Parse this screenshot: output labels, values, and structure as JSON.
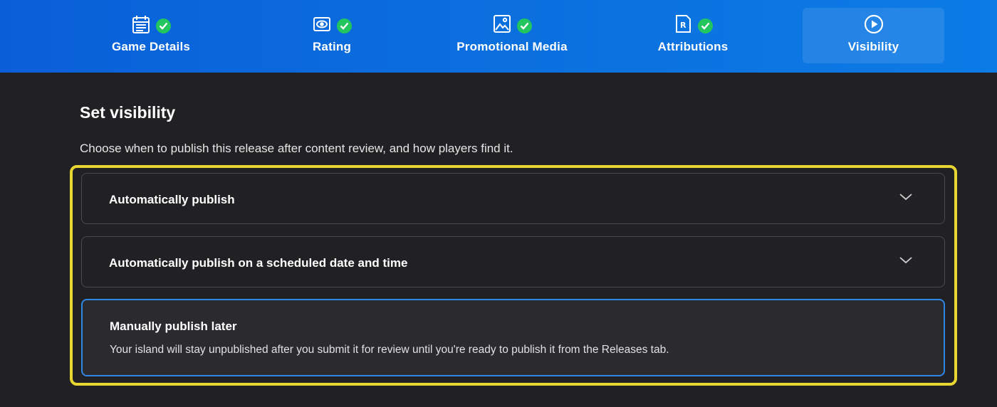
{
  "steps": [
    {
      "label": "Game Details",
      "icon": "calendar-icon",
      "completed": true,
      "active": false
    },
    {
      "label": "Rating",
      "icon": "eye-icon",
      "completed": true,
      "active": false
    },
    {
      "label": "Promotional Media",
      "icon": "image-icon",
      "completed": true,
      "active": false
    },
    {
      "label": "Attributions",
      "icon": "document-r-icon",
      "completed": true,
      "active": false
    },
    {
      "label": "Visibility",
      "icon": "play-circle-icon",
      "completed": false,
      "active": true
    }
  ],
  "section": {
    "title": "Set visibility",
    "subtitle": "Choose when to publish this release after content review, and how players find it."
  },
  "options": [
    {
      "title": "Automatically publish",
      "expandable": true,
      "selected": false
    },
    {
      "title": "Automatically publish on a scheduled date and time",
      "expandable": true,
      "selected": false
    },
    {
      "title": "Manually publish later",
      "description": "Your island will stay unpublished after you submit it for review until you're ready to publish it from the Releases tab.",
      "expandable": false,
      "selected": true
    }
  ],
  "colors": {
    "topbar": "#0b6fde",
    "background": "#212124",
    "check": "#22c55e",
    "selected_border": "#2f86e4",
    "highlight": "#e8d631"
  }
}
